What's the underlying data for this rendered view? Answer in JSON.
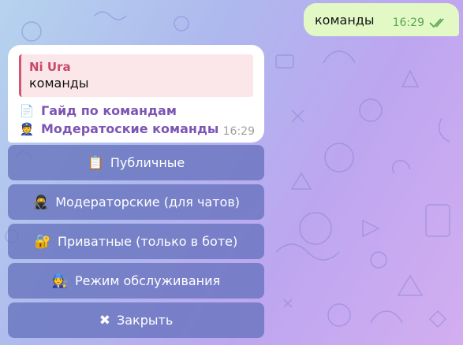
{
  "outgoing": {
    "text": "команды",
    "time": "16:29",
    "status_icon": "double-check-icon"
  },
  "incoming": {
    "reply": {
      "author": "Ni Ura",
      "text": "команды"
    },
    "links": [
      {
        "emoji": "📄",
        "label": "Гайд по командам"
      },
      {
        "emoji": "👮",
        "label": "Модератоские команды"
      }
    ],
    "time": "16:29"
  },
  "keyboard": [
    {
      "emoji": "📋",
      "label": "Публичные"
    },
    {
      "emoji": "🥷",
      "label": "Модераторские (для чатов)"
    },
    {
      "emoji": "🔐",
      "label": "Приватные (только в боте)"
    },
    {
      "emoji": "🧑‍🔧",
      "label": "Режим обслуживания"
    },
    {
      "emoji": "✖",
      "label": "Закрыть"
    }
  ],
  "colors": {
    "outgoing_bubble": "#e3f9c5",
    "reply_accent": "#c9496a",
    "link": "#7d55b4",
    "keyboard_button": "#6772bc"
  }
}
